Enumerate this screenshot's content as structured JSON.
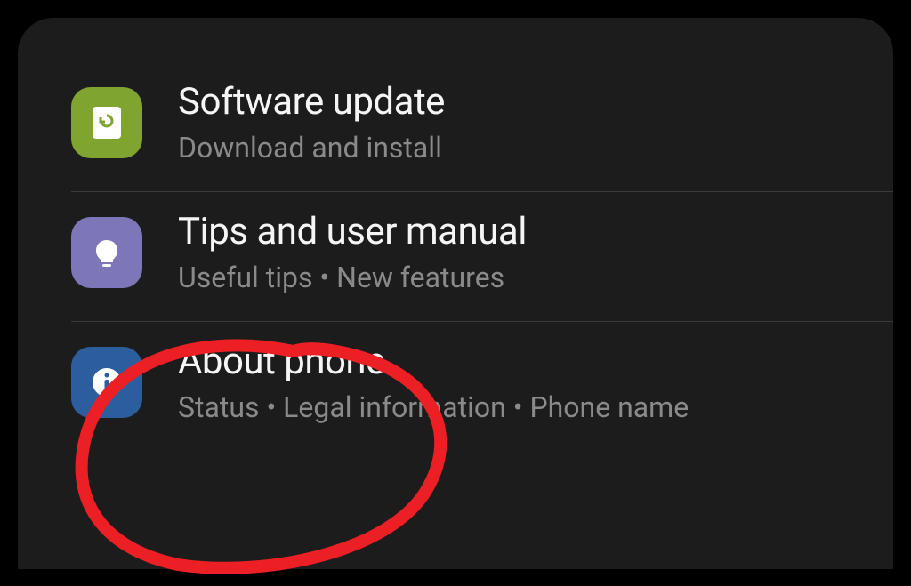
{
  "settings": {
    "items": [
      {
        "title": "Software update",
        "subtitle": "Download and install",
        "icon": "download-refresh"
      },
      {
        "title": "Tips and user manual",
        "subtitle": "Useful tips  •  New features",
        "icon": "lightbulb"
      },
      {
        "title": "About phone",
        "subtitle": "Status  •  Legal information  •  Phone name",
        "icon": "info"
      }
    ]
  },
  "colors": {
    "background": "#000000",
    "panel": "#1c1c1c",
    "title_text": "#f5f5f5",
    "subtitle_text": "#8a8a8a",
    "icon_green": "#7fa530",
    "icon_purple": "#7d77b8",
    "icon_blue": "#2c5e9e",
    "annotation_red": "#eb1f24"
  }
}
